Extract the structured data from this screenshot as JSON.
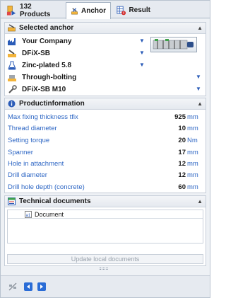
{
  "tabs": [
    {
      "label": "132 Products",
      "icon": "products-stack-icon"
    },
    {
      "label": "Anchor",
      "icon": "anchor-tools-icon",
      "active": true
    },
    {
      "label": "Result",
      "icon": "result-grid-warning-icon"
    }
  ],
  "selected_anchor": {
    "title": "Selected anchor",
    "rows": [
      {
        "label": "Your Company",
        "icon": "factory-icon"
      },
      {
        "label": "DFiX-SB",
        "icon": "anchor-type-icon"
      },
      {
        "label": "Zinc-plated 5.8",
        "icon": "flask-icon"
      },
      {
        "label": "Through-bolting",
        "icon": "bolting-icon"
      },
      {
        "label": "DFiX-SB M10",
        "icon": "wrench-icon"
      }
    ]
  },
  "productinformation": {
    "title": "Productinformation",
    "rows": [
      {
        "label": "Max fixing thickness tfix",
        "value": "925",
        "unit": "mm"
      },
      {
        "label": "Thread diameter",
        "value": "10",
        "unit": "mm"
      },
      {
        "label": "Setting torque",
        "value": "20",
        "unit": "Nm"
      },
      {
        "label": "Spanner",
        "value": "17",
        "unit": "mm"
      },
      {
        "label": "Hole in attachment",
        "value": "12",
        "unit": "mm"
      },
      {
        "label": "Drill diameter",
        "value": "12",
        "unit": "mm"
      },
      {
        "label": "Drill hole depth (concrete)",
        "value": "60",
        "unit": "mm"
      }
    ]
  },
  "technical_documents": {
    "title": "Technical documents",
    "column": "Document",
    "update_button": "Update local documents"
  },
  "colors": {
    "accent": "#2b5cb8",
    "label_blue": "#2d66c4"
  }
}
